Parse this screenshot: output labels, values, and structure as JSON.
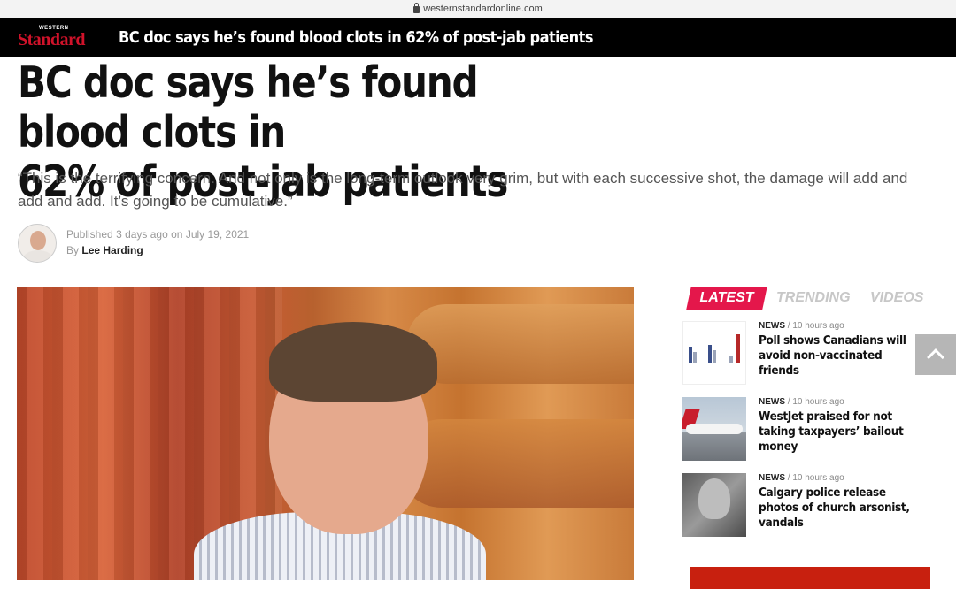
{
  "browser": {
    "url": "westernstandardonline.com"
  },
  "sticky_header": {
    "logo_small": "WESTERN",
    "logo_big": "Standard",
    "title": "BC doc says he’s found blood clots in 62% of post-jab patients"
  },
  "article": {
    "headline_line1": "BC doc says he’s found blood clots in",
    "headline_line2": "62% of post-jab patients",
    "dek": "“This is the terrifying concern. And not only is the long-term outlook very grim, but with each successive shot, the damage will add and add and add. It’s going to be cumulative.”",
    "published_prefix": "Published",
    "published_relative": "3 days ago",
    "published_on": "on",
    "published_date": "July 19, 2021",
    "by_prefix": "By",
    "author": "Lee Harding"
  },
  "sidebar": {
    "tabs": {
      "latest": "LATEST",
      "trending": "TRENDING",
      "videos": "VIDEOS"
    },
    "items": [
      {
        "category": "NEWS",
        "separator": "/",
        "time": "10 hours ago",
        "title": "Poll shows Canadians will avoid non-vaccinated friends",
        "thumb_icon": "chart-thumbnail"
      },
      {
        "category": "NEWS",
        "separator": "/",
        "time": "10 hours ago",
        "title": "WestJet praised for not taking taxpayers’ bailout money",
        "thumb_icon": "airplane-thumbnail"
      },
      {
        "category": "NEWS",
        "separator": "/",
        "time": "10 hours ago",
        "title": "Calgary police release photos of church arsonist, vandals",
        "thumb_icon": "security-camera-thumbnail"
      }
    ]
  },
  "colors": {
    "accent_red": "#e4174b",
    "header_bg": "#000000",
    "logo_red": "#d0122a"
  }
}
